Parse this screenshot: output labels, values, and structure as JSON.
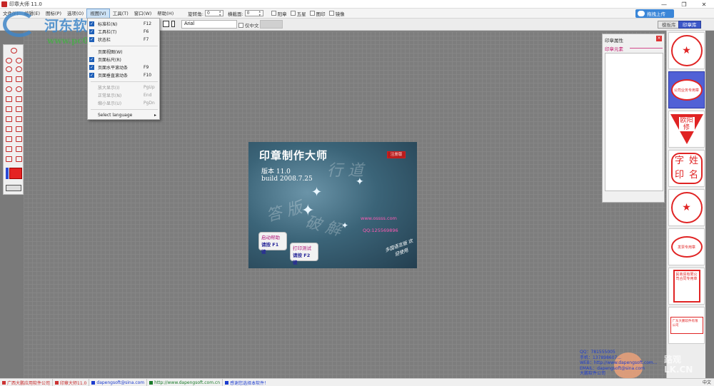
{
  "window": {
    "title": "印章大师 11.0",
    "controls": [
      "—",
      "❐",
      "✕"
    ]
  },
  "menubar": {
    "items": [
      "文件(F)",
      "编辑(E)",
      "图标(P)",
      "选项(O)",
      "视图(V)",
      "工具(T)",
      "窗口(W)",
      "帮助(H)"
    ],
    "active_index": 4,
    "rotate_label": "旋转角:",
    "rotate_value": "0",
    "tilt_label": "横截面:",
    "tilt_value": "0",
    "checks": [
      "阳章",
      "五星",
      "图印",
      "镜像"
    ],
    "upload_button": "拖拽上传"
  },
  "toolbar2": {
    "font": "Arial",
    "chinese_only": "仅中文"
  },
  "tabs": {
    "left": "模板库",
    "right": "印章库"
  },
  "dropdown": {
    "items": [
      {
        "label": "标准栏(N)",
        "shortcut": "F12",
        "checked": true,
        "disabled": false
      },
      {
        "label": "工具栏(T)",
        "shortcut": "F6",
        "checked": true,
        "disabled": false
      },
      {
        "label": "状态栏",
        "shortcut": "F7",
        "checked": true,
        "disabled": false
      },
      {
        "label": "页面视图(W)",
        "shortcut": "",
        "checked": false,
        "disabled": false
      },
      {
        "label": "页面标尺(R)",
        "shortcut": "",
        "checked": true,
        "disabled": false
      },
      {
        "label": "页面水平滚动条",
        "shortcut": "F9",
        "checked": true,
        "disabled": false
      },
      {
        "label": "页面垂直滚动条",
        "shortcut": "F10",
        "checked": true,
        "disabled": false
      },
      {
        "label": "放大显示(I)",
        "shortcut": "PgUp",
        "checked": false,
        "disabled": true
      },
      {
        "label": "正常显示(N)",
        "shortcut": "End",
        "checked": false,
        "disabled": true
      },
      {
        "label": "缩小显示(U)",
        "shortcut": "PgDn",
        "checked": false,
        "disabled": true
      },
      {
        "label": "Select language",
        "shortcut": "▸",
        "checked": false,
        "disabled": false
      }
    ]
  },
  "splash": {
    "title": "印章制作大师",
    "badge": "注册版",
    "version": "版本 11.0",
    "build": "build 2008.7.25",
    "deco1": "行 道",
    "deco2": "答 版",
    "deco3": "破 解",
    "website": "www.ossss.com",
    "qq": "QQ:125569896",
    "help_button": {
      "line1": "启动帮助",
      "line2": "请按 F1 键"
    },
    "print_button": {
      "line1": "打印测试",
      "line2": "请按 F2 键"
    },
    "side_text": "多国语言版 欢迎使用"
  },
  "properties": {
    "title": "印章属性",
    "section": "印章元素"
  },
  "stamps": [
    {
      "type": "circle",
      "text": "★"
    },
    {
      "type": "oval",
      "text": "公司业务专用章"
    },
    {
      "type": "triangle",
      "text": "欧阳修"
    },
    {
      "type": "rounded-square",
      "chars": [
        "字",
        "姓",
        "印",
        "名"
      ]
    },
    {
      "type": "circle",
      "text": "★"
    },
    {
      "type": "oval",
      "text": "发票专用章"
    },
    {
      "type": "rect",
      "text": "民商贸有限公司合同专用章"
    },
    {
      "type": "rect2",
      "text": "广东大鹏软件有限公司"
    }
  ],
  "watermark": {
    "line1": "河东软件园",
    "line2": "www.pc0359.cn"
  },
  "contact": {
    "qq": "QQ：781555005",
    "phone": "手机：137898607...",
    "web": "WEB：http://www.dapengsoft.com...",
    "email": "EMAIL：dapengsoft@sina.com",
    "company": "大鹏软件公司"
  },
  "corner_wm": {
    "line1": "路观",
    "line2": "LK.CN"
  },
  "statusbar": {
    "items": [
      "广西大鹏应用软件公司",
      "印章大师11.0",
      "dapengsoft@sina.com",
      "http://www.dapengsoft.com.cn",
      "感谢您选择本软件！"
    ],
    "ime": "中文"
  },
  "colors": {
    "accent": "#3a86d8",
    "stamp_red": "#e02424",
    "selected_tab": "#3b57c8"
  }
}
